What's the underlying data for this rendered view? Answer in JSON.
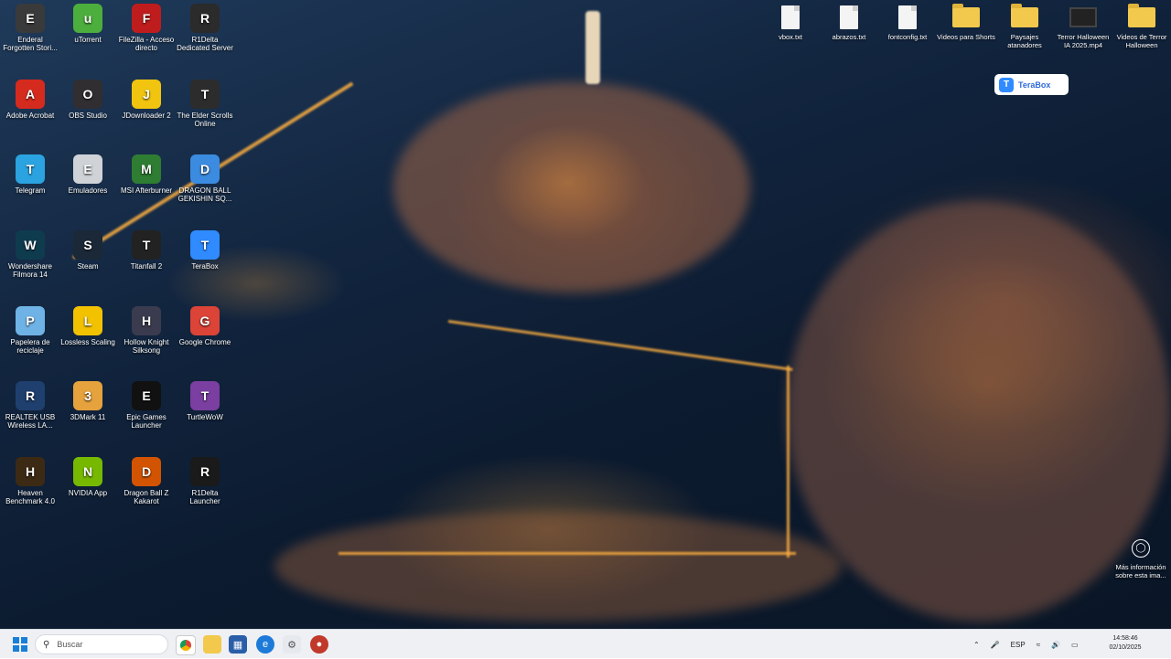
{
  "desktop_icons": [
    {
      "label": "Enderal Forgotten Stori...",
      "icon": "enderal-icon",
      "color": "#3a3a3a"
    },
    {
      "label": "uTorrent",
      "icon": "utorrent-icon",
      "color": "#4cae3c"
    },
    {
      "label": "FileZilla - Acceso directo",
      "icon": "filezilla-icon",
      "color": "#bf1d1d"
    },
    {
      "label": "R1Delta Dedicated Server",
      "icon": "r1delta-icon",
      "color": "#2b2b2b"
    },
    {
      "label": "Adobe Acrobat",
      "icon": "acrobat-icon",
      "color": "#d52b1e"
    },
    {
      "label": "OBS Studio",
      "icon": "obs-icon",
      "color": "#302e31"
    },
    {
      "label": "JDownloader 2",
      "icon": "jdownloader-icon",
      "color": "#f1c40f"
    },
    {
      "label": "The Elder Scrolls Online",
      "icon": "elder-scrolls-icon",
      "color": "#2c2c2c"
    },
    {
      "label": "Telegram",
      "icon": "telegram-icon",
      "color": "#2aa3e0"
    },
    {
      "label": "Emuladores",
      "icon": "disc-icon",
      "color": "#cfd3d8"
    },
    {
      "label": "MSI Afterburner",
      "icon": "msi-afterburner-icon",
      "color": "#2e7d32"
    },
    {
      "label": "DRAGON BALL GEKISHIN SQ...",
      "icon": "dragonball-icon",
      "color": "#3b8be0"
    },
    {
      "label": "Wondershare Filmora 14",
      "icon": "filmora-icon",
      "color": "#0f3b4f"
    },
    {
      "label": "Steam",
      "icon": "steam-icon",
      "color": "#1b2838"
    },
    {
      "label": "Titanfall 2",
      "icon": "titanfall-icon",
      "color": "#222222"
    },
    {
      "label": "TeraBox",
      "icon": "terabox-icon",
      "color": "#2f8bff"
    },
    {
      "label": "Papelera de reciclaje",
      "icon": "recycle-bin-icon",
      "color": "#6fb3e6"
    },
    {
      "label": "Lossless Scaling",
      "icon": "lossless-scaling-icon",
      "color": "#f2c200"
    },
    {
      "label": "Hollow Knight Silksong",
      "icon": "silksong-icon",
      "color": "#3b3b4f"
    },
    {
      "label": "Google Chrome",
      "icon": "chrome-icon",
      "color": "#db4437"
    },
    {
      "label": "REALTEK USB Wireless LA...",
      "icon": "realtek-icon",
      "color": "#1f3f6e"
    },
    {
      "label": "3DMark 11",
      "icon": "3dmark-icon",
      "color": "#e6a23c"
    },
    {
      "label": "Epic Games Launcher",
      "icon": "epic-games-icon",
      "color": "#111111"
    },
    {
      "label": "TurtleWoW",
      "icon": "turtlewow-icon",
      "color": "#7a3fa0"
    },
    {
      "label": "Heaven Benchmark 4.0",
      "icon": "heaven-icon",
      "color": "#3d2a14"
    },
    {
      "label": "NVIDIA App",
      "icon": "nvidia-icon",
      "color": "#76b900"
    },
    {
      "label": "Dragon Ball Z Kakarot",
      "icon": "dbz-kakarot-icon",
      "color": "#d35400"
    },
    {
      "label": "R1Delta Launcher",
      "icon": "r1delta-launcher-icon",
      "color": "#1a1a1a"
    }
  ],
  "file_icons": [
    {
      "label": "vbox.txt",
      "type": "doc"
    },
    {
      "label": "abrazos.txt",
      "type": "doc"
    },
    {
      "label": "fontconfig.txt",
      "type": "doc"
    },
    {
      "label": "Videos para Shorts",
      "type": "folder"
    },
    {
      "label": "Paysajes atanadores",
      "type": "folder"
    },
    {
      "label": "Terror Halloween IA 2025.mp4",
      "type": "video"
    },
    {
      "label": "Videos de Terror Halloween",
      "type": "folder"
    }
  ],
  "terabox_badge": "TeraBox",
  "more_info": "Más información sobre esta ima...",
  "taskbar": {
    "search_placeholder": "Buscar",
    "language": "ESP",
    "time": "14:58:46",
    "date": "02/10/2025"
  },
  "colors": {
    "taskbar_bg": "#eef0f4",
    "accent": "#1a7fd8"
  }
}
